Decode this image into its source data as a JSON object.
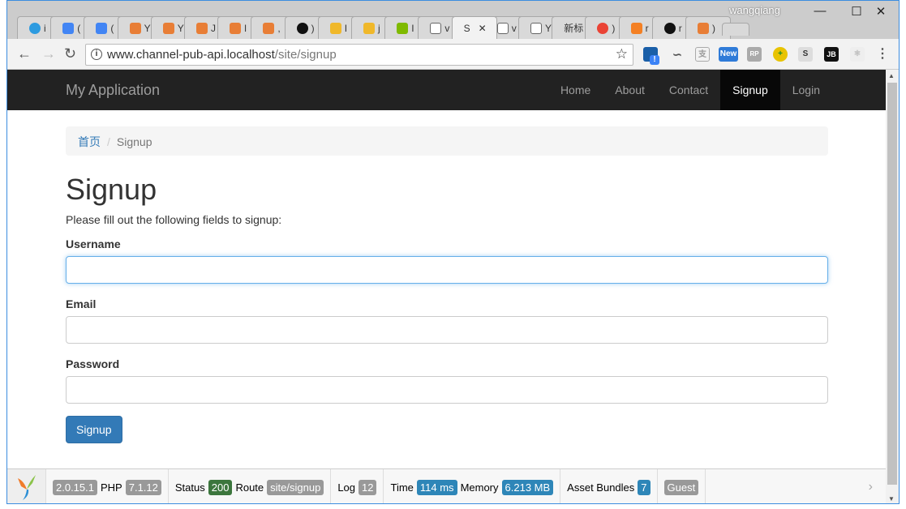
{
  "browser": {
    "user": "wangqiang",
    "tabs": [
      {
        "label": "i",
        "icon": "globe-icon",
        "color": "#2d9be0"
      },
      {
        "label": "(",
        "icon": "google-translate-icon",
        "color": "#4285f4"
      },
      {
        "label": "(",
        "icon": "google-translate-icon",
        "color": "#4285f4"
      },
      {
        "label": "Y",
        "icon": "yii-icon",
        "color": "#e87e36"
      },
      {
        "label": "Y",
        "icon": "yii-icon",
        "color": "#e87e36"
      },
      {
        "label": "J",
        "icon": "yii-icon",
        "color": "#e87e36"
      },
      {
        "label": "l",
        "icon": "yii-icon",
        "color": "#e87e36"
      },
      {
        "label": ",",
        "icon": "yii-icon",
        "color": "#e87e36"
      },
      {
        "label": ")",
        "icon": "github-icon",
        "color": "#111"
      },
      {
        "label": "I",
        "icon": "qq-icon",
        "color": "#f0b82a"
      },
      {
        "label": "j",
        "icon": "qq-icon",
        "color": "#f0b82a"
      },
      {
        "label": "I",
        "icon": "microsoft-icon",
        "color": "#7fba00"
      },
      {
        "label": "v",
        "icon": "page-icon",
        "color": "#fff"
      },
      {
        "label": "S",
        "icon": "none",
        "color": "#f2f2f2",
        "active": true
      },
      {
        "label": "v",
        "icon": "page-icon",
        "color": "#fff"
      },
      {
        "label": "Y",
        "icon": "page-icon",
        "color": "#fff"
      },
      {
        "label": "新标",
        "icon": "none",
        "color": "#d9d9d9"
      },
      {
        "label": ")",
        "icon": "google-icon",
        "color": "#ea4335"
      },
      {
        "label": "r",
        "icon": "stackoverflow-icon",
        "color": "#f48024"
      },
      {
        "label": "r",
        "icon": "github-icon",
        "color": "#111"
      },
      {
        "label": ")",
        "icon": "yii-icon",
        "color": "#e87e36"
      }
    ],
    "url_host": "www.channel-pub-api.localhost",
    "url_path": "/site/signup",
    "ext_new_badge": "New",
    "ext_alert_badge": "!"
  },
  "navbar": {
    "brand": "My Application",
    "items": [
      "Home",
      "About",
      "Contact",
      "Signup",
      "Login"
    ],
    "active": "Signup"
  },
  "breadcrumb": {
    "home": "首页",
    "current": "Signup"
  },
  "page": {
    "title": "Signup",
    "intro": "Please fill out the following fields to signup:"
  },
  "form": {
    "username_label": "Username",
    "username_value": "",
    "email_label": "Email",
    "email_value": "",
    "password_label": "Password",
    "password_value": "",
    "submit": "Signup"
  },
  "debug": {
    "yii_version": "2.0.15.1",
    "php_label": "PHP",
    "php_version": "7.1.12",
    "status_label": "Status",
    "status": "200",
    "route_label": "Route",
    "route": "site/signup",
    "log_label": "Log",
    "log": "12",
    "time_label": "Time",
    "time": "114 ms",
    "memory_label": "Memory",
    "memory": "6.213 MB",
    "assets_label": "Asset Bundles",
    "assets": "7",
    "user": "Guest"
  }
}
